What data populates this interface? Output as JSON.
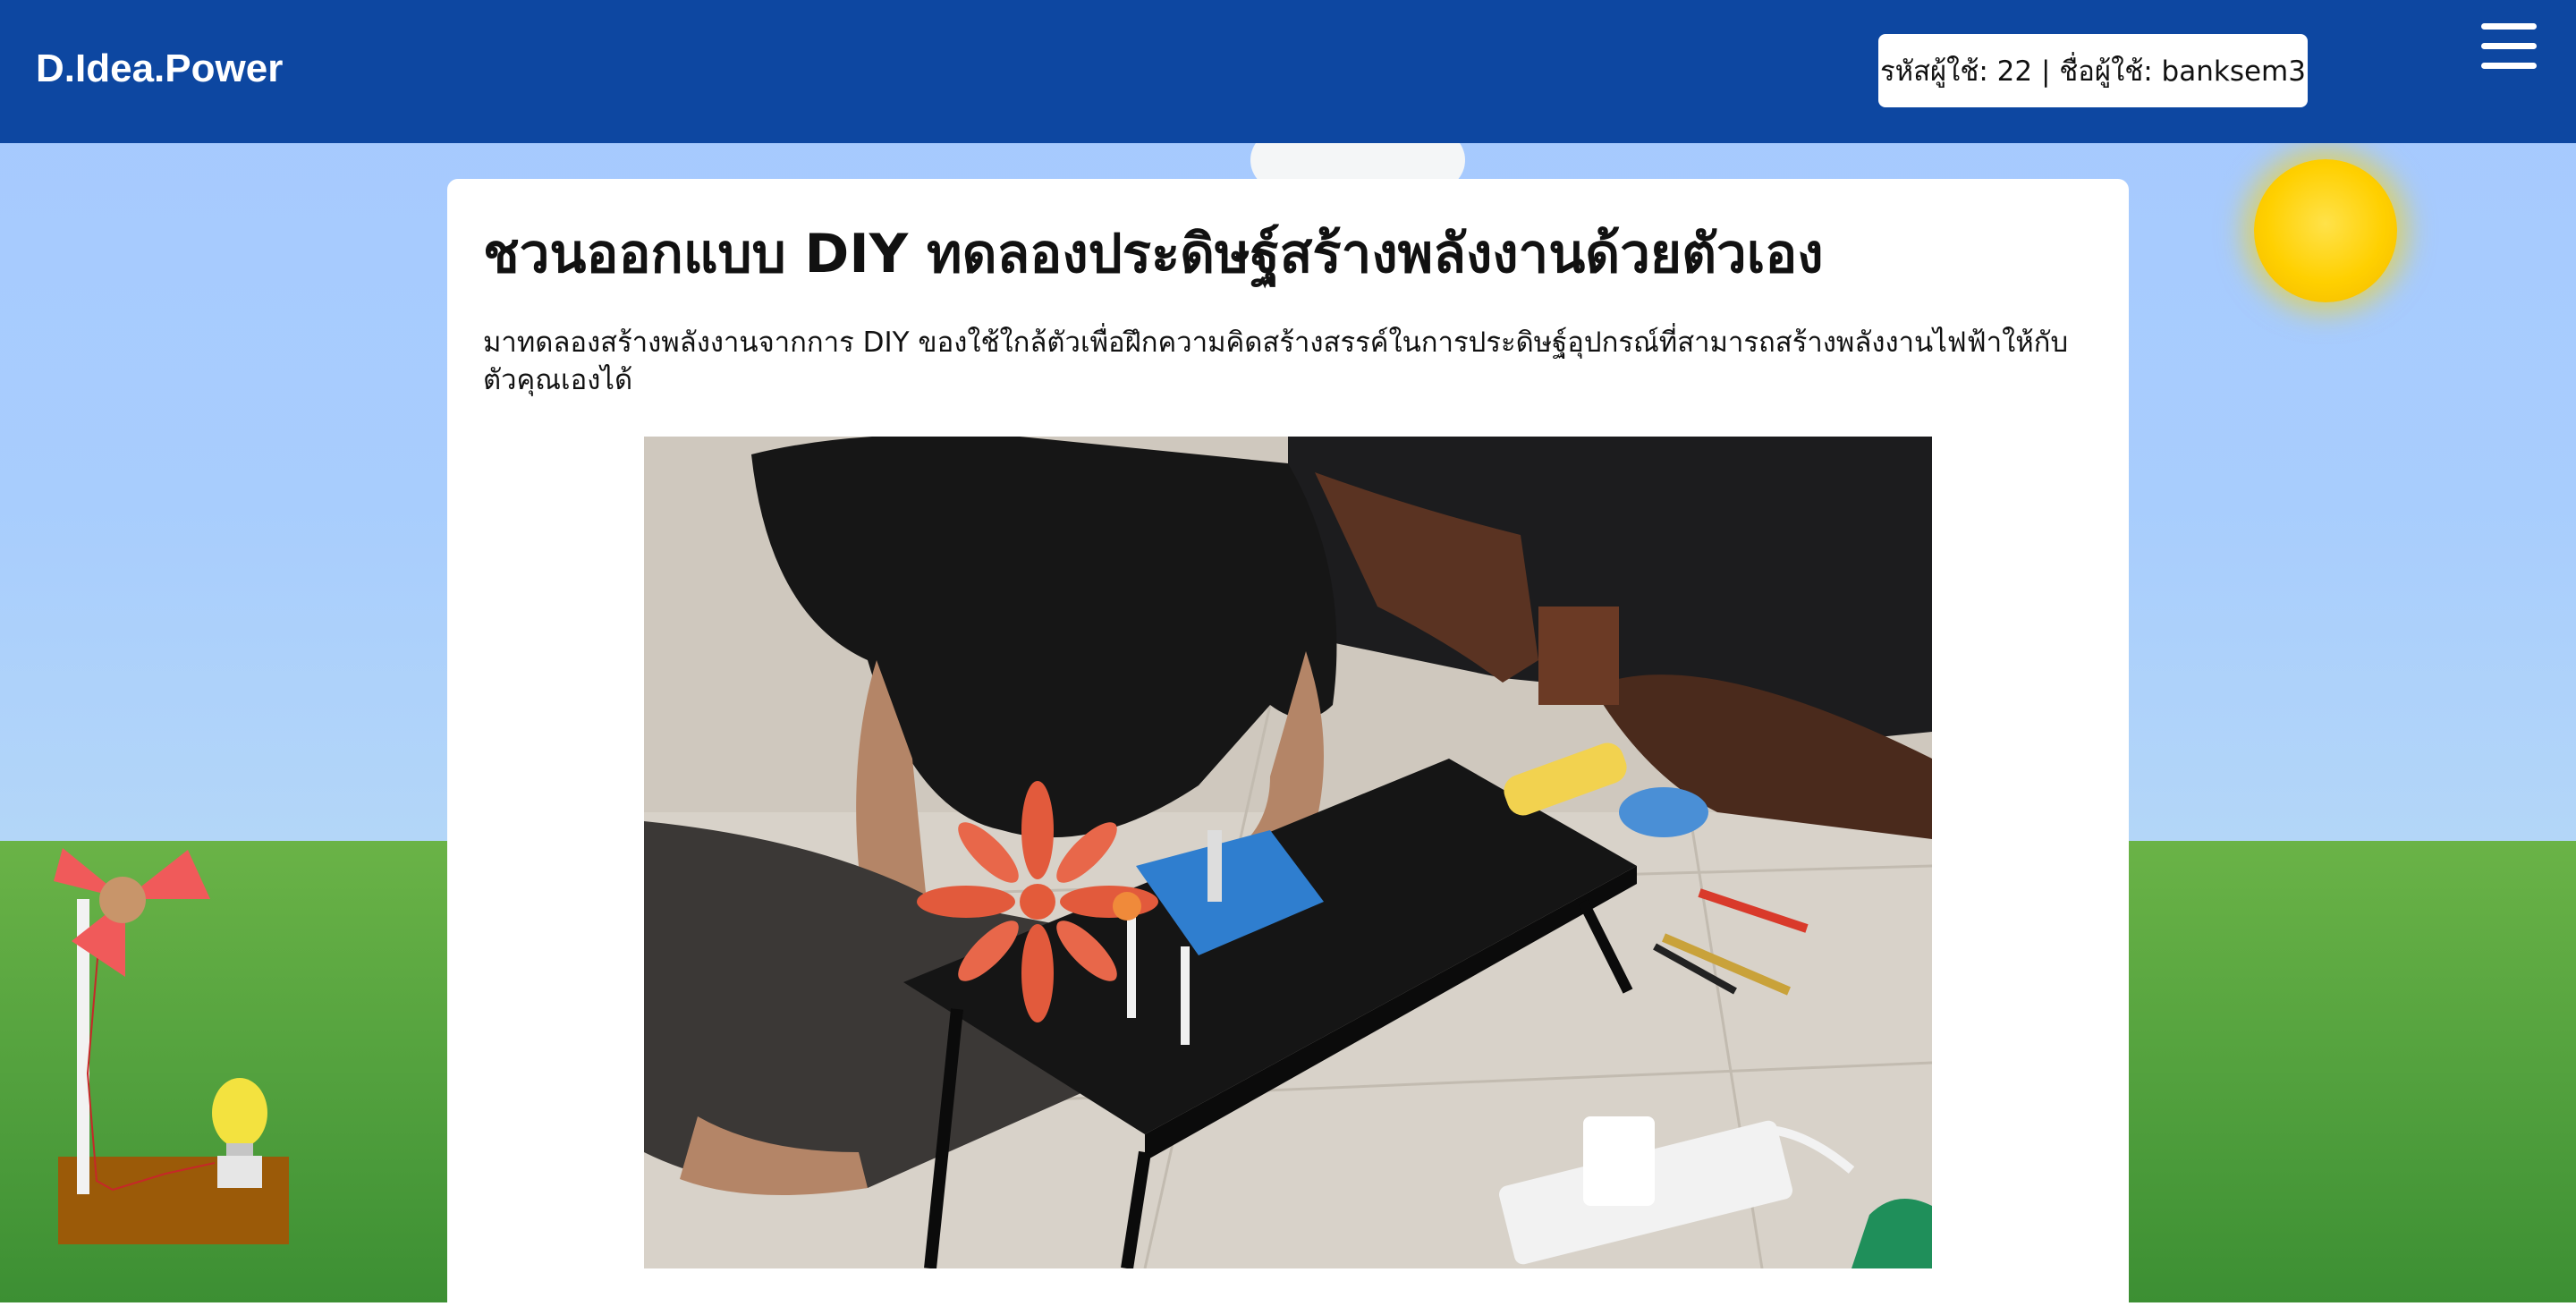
{
  "header": {
    "brand": "D.Idea.Power",
    "user_info": "รหัสผู้ใช้: 22 | ชื่อผู้ใช้: banksem3",
    "menu_icon": "hamburger-icon"
  },
  "article": {
    "title": "ชวนออกแบบ DIY ทดลองประดิษฐ์สร้างพลังงานด้วยตัวเอง",
    "description": "มาทดลองสร้างพลังงานจากการ DIY ของใช้ใกล้ตัวเพื่อฝึกความคิดสร้างสรรค์ในการประดิษฐ์อุปกรณ์ที่สามารถสร้างพลังงานไฟฟ้าให้กับตัวคุณเองได้",
    "image_icon": "photo-icon"
  },
  "scene": {
    "sun_icon": "sun-icon",
    "windmill_icon": "windmill-icon",
    "bulb_icon": "lightbulb-icon"
  },
  "colors": {
    "header": "#0d47a1",
    "sky": "#a6c9ff",
    "ground": "#5aa742",
    "sun": "#ffd000",
    "windmill_blade": "#f06060"
  }
}
